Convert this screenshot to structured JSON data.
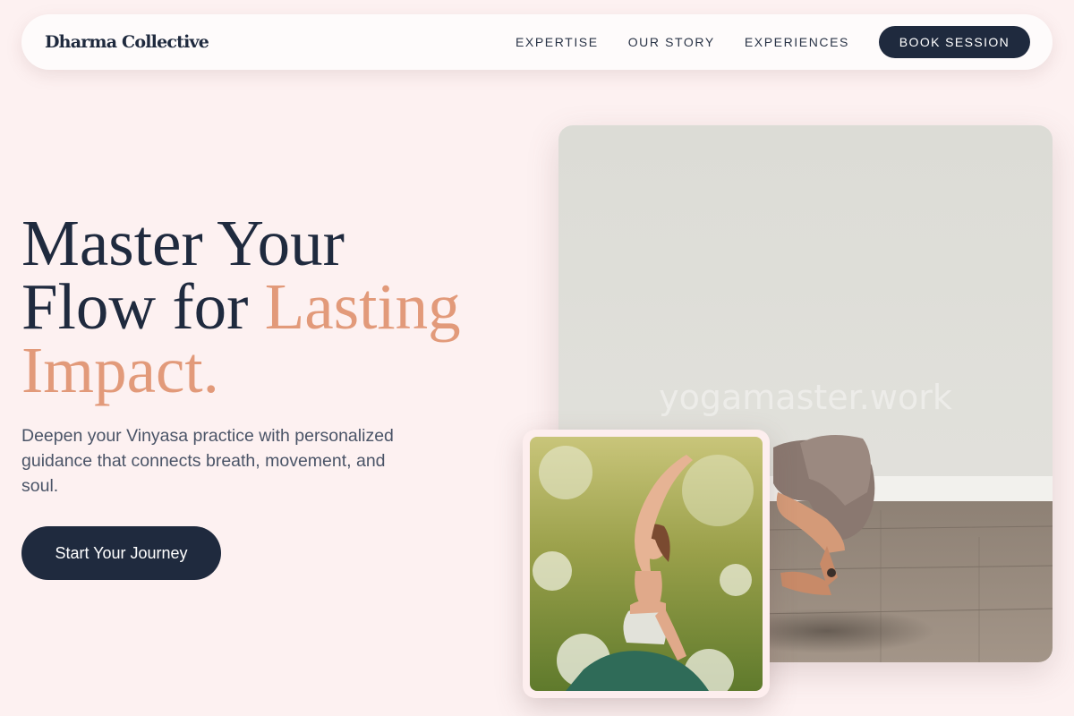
{
  "brand": {
    "name": "Dharma Collective"
  },
  "nav": {
    "links": [
      "EXPERTISE",
      "OUR STORY",
      "EXPERIENCES"
    ],
    "cta": "BOOK SESSION"
  },
  "hero": {
    "title_line1": "Master Your",
    "title_line2_prefix": "Flow for ",
    "title_line2_accent": "Lasting",
    "title_line3_accent": "Impact.",
    "description": "Deepen your Vinyasa practice with personalized guidance that connects breath, movement, and soul.",
    "cta": "Start Your Journey"
  },
  "photos": {
    "main_watermark": "yogamaster.work",
    "main_alt": "yoga-arm-balance-photo",
    "inset_alt": "yoga-side-stretch-in-meadow-photo"
  },
  "colors": {
    "background": "#fdf1f1",
    "navy": "#1f2a3e",
    "accent": "#e29a7a",
    "text_muted": "#4a5467"
  }
}
